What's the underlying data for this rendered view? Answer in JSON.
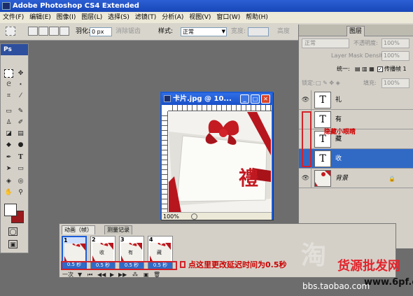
{
  "app": {
    "title": "Adobe Photoshop CS4 Extended"
  },
  "menu": [
    "文件(F)",
    "编辑(E)",
    "图像(I)",
    "图层(L)",
    "选择(S)",
    "滤镜(T)",
    "分析(A)",
    "视图(V)",
    "窗口(W)",
    "帮助(H)"
  ],
  "options_bar": {
    "feather_label": "羽化:",
    "feather_value": "0 px",
    "antialias_label": "消除锯齿",
    "style_label": "样式:",
    "style_value": "正常",
    "width_label": "宽度:",
    "height_label": "高度"
  },
  "toolbox": {
    "badge": "Ps"
  },
  "document": {
    "title": "卡片.jpg @ 10...",
    "zoom": "100%",
    "card_char": "禮"
  },
  "layers_panel": {
    "tab_label": "图层",
    "blend_mode": "正常",
    "opacity_label": "不透明度:",
    "opacity_value": "100%",
    "mask_density_label": "Layer Mask Density",
    "mask_density_value": "100%",
    "unify_label": "统一:",
    "propagate_label": "传播帧 1",
    "lock_label": "锁定:",
    "fill_label": "填充:",
    "fill_value": "100%",
    "layers": [
      {
        "name": "礼",
        "thumb": "T"
      },
      {
        "name": "有",
        "thumb": "T"
      },
      {
        "name": "藏",
        "thumb": "T"
      },
      {
        "name": "收",
        "thumb": "T"
      },
      {
        "name": "背景",
        "thumb": ""
      }
    ],
    "annotation": "隐藏小眼睛"
  },
  "animation_panel": {
    "tabs": [
      "动画（帧）",
      "测量记录"
    ],
    "frames": [
      {
        "num": "1",
        "delay": "0.5 秒",
        "char": ""
      },
      {
        "num": "2",
        "delay": "0.5 秒",
        "char": "收"
      },
      {
        "num": "3",
        "delay": "0.5 秒",
        "char": "有"
      },
      {
        "num": "4",
        "delay": "0.5 秒",
        "char": "藏"
      }
    ],
    "loop": "一次",
    "annotation": "点这里更改延迟时间为0.5秒"
  },
  "watermarks": {
    "taobao": "bbs.taobao.com",
    "site": "货源批发网",
    "site2": "www.6pf.cn",
    "wm_char": "淘"
  },
  "colors": {
    "accent": "#316ac5",
    "annotation_red": "#d2232a",
    "bow_red": "#c41a22"
  }
}
